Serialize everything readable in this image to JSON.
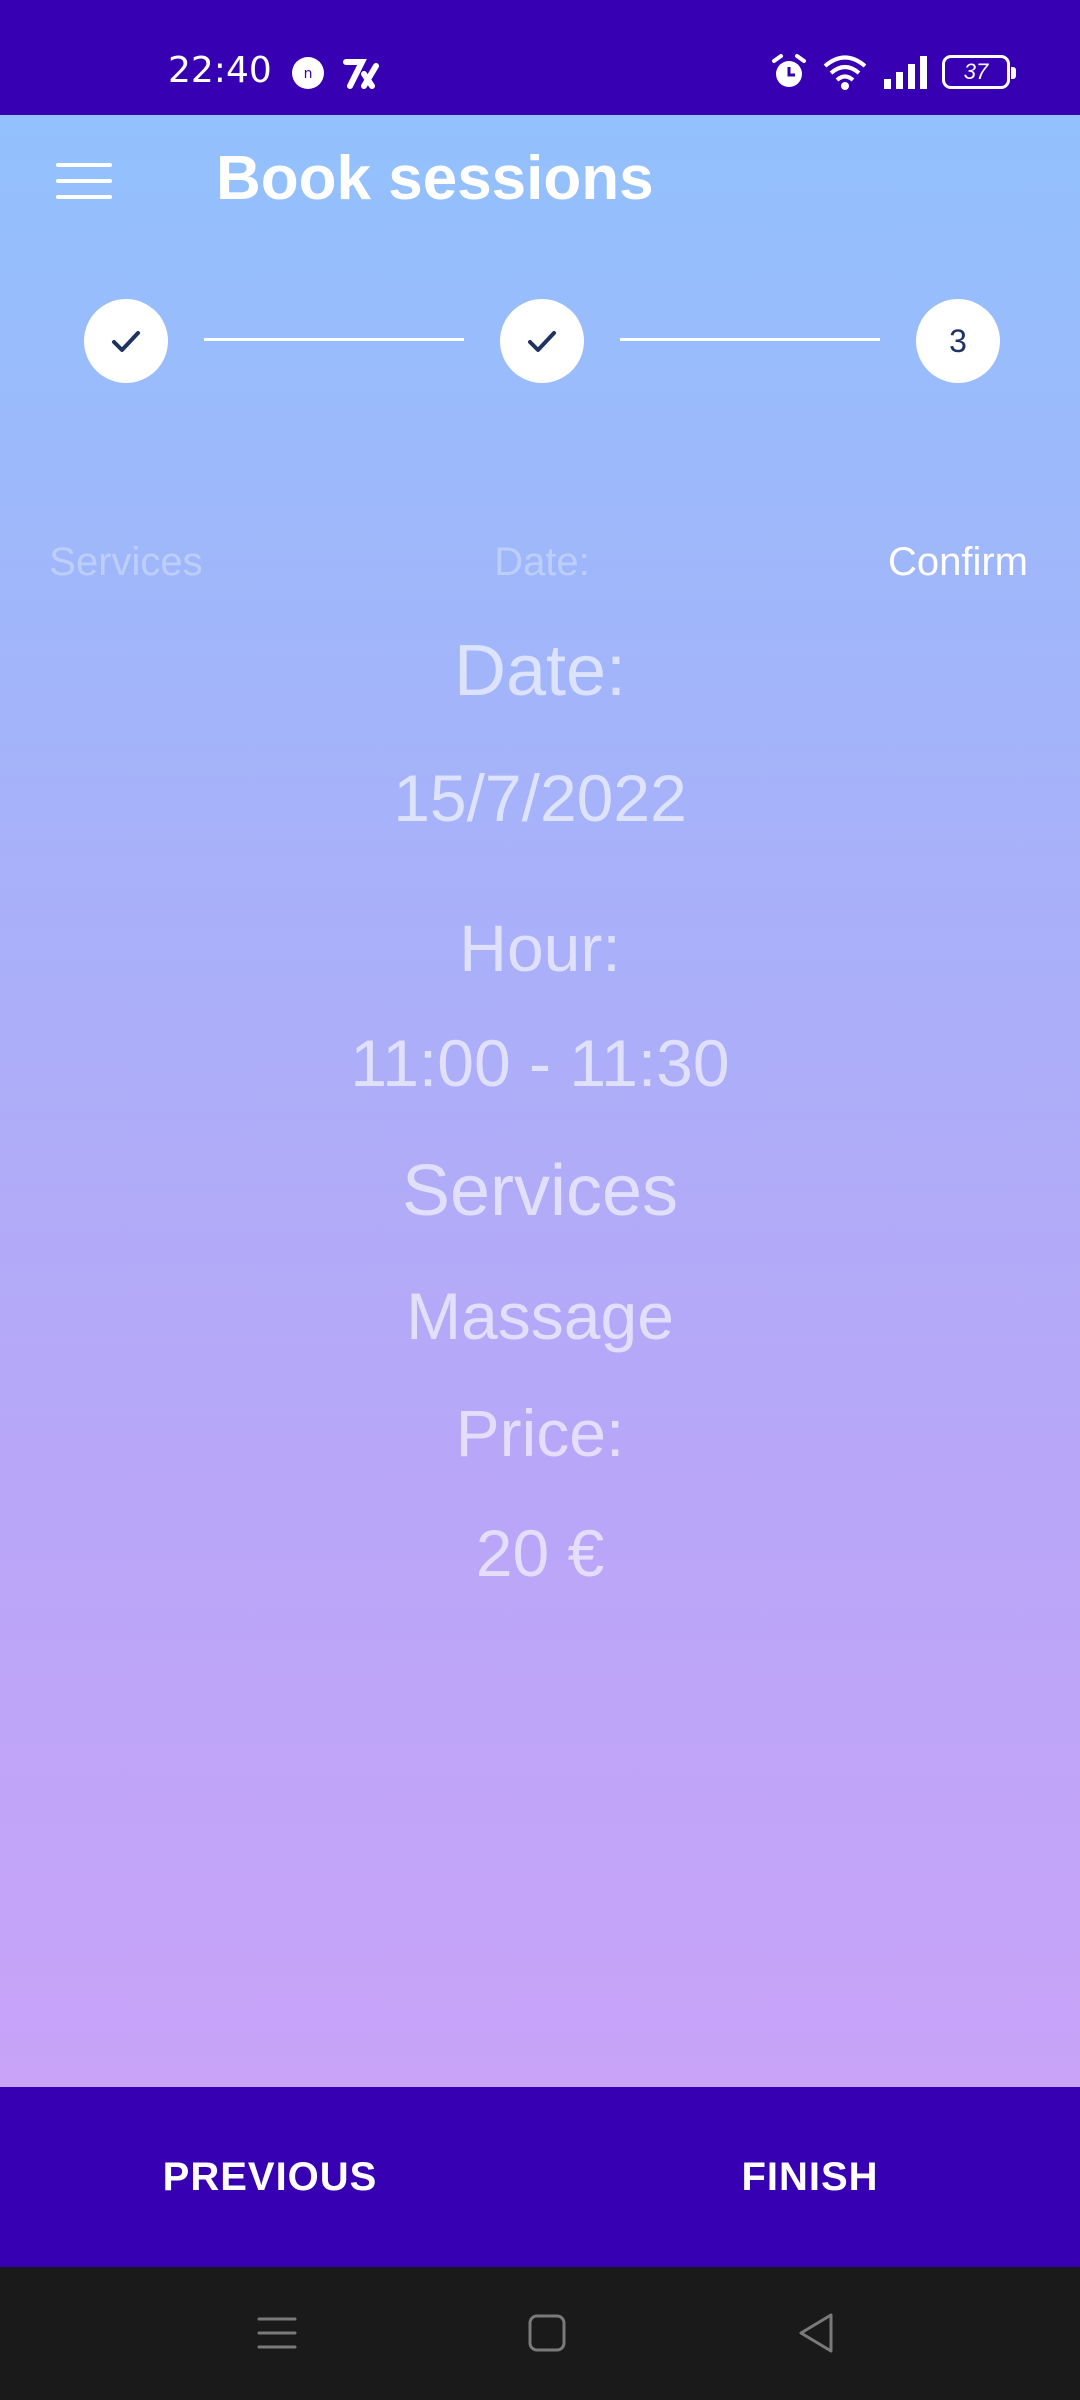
{
  "status_bar": {
    "time": "22:40",
    "battery_level": "37",
    "icons": [
      "notification-n-icon",
      "app-logo-icon",
      "alarm-icon",
      "wifi-icon",
      "signal-icon",
      "battery-icon"
    ]
  },
  "header": {
    "title": "Book sessions",
    "menu_icon": "hamburger-menu-icon"
  },
  "stepper": {
    "steps": [
      {
        "label": "Services",
        "state": "done",
        "marker": "✓"
      },
      {
        "label": "Date:",
        "state": "done",
        "marker": "✓"
      },
      {
        "label": "Confirm",
        "state": "active",
        "marker": "3"
      }
    ]
  },
  "summary": {
    "date_heading": "Date:",
    "date_value": "15/7/2022",
    "hour_heading": "Hour:",
    "hour_value": "11:00 - 11:30",
    "services_heading": "Services",
    "services_value": "Massage",
    "price_heading": "Price:",
    "price_value": "20 €"
  },
  "bottom_bar": {
    "previous_label": "PREVIOUS",
    "finish_label": "FINISH"
  },
  "nav_bar": {
    "icons": [
      "recent-apps-icon",
      "home-icon",
      "back-icon"
    ]
  },
  "colors": {
    "primary": "#3700b3",
    "gradient_top": "#92c1fd",
    "gradient_bottom": "#c8a3f8",
    "step_check": "#1e3264"
  }
}
